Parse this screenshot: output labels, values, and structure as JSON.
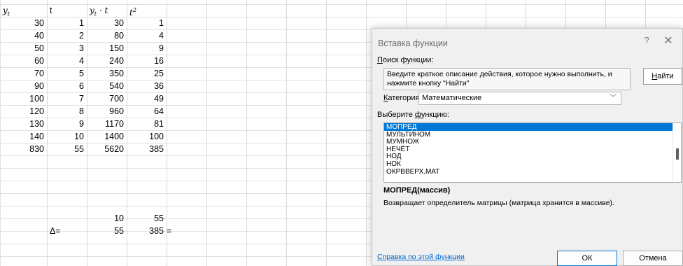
{
  "sheet": {
    "headers": {
      "col1": {
        "base": "y",
        "sub": "t"
      },
      "col2": "t",
      "col3": {
        "base": "y",
        "sub": "t",
        "rest": " · t"
      },
      "col4": {
        "base": "t",
        "sup": "2"
      }
    },
    "rows": [
      [
        "30",
        "1",
        "30",
        "1"
      ],
      [
        "40",
        "2",
        "80",
        "4"
      ],
      [
        "50",
        "3",
        "150",
        "9"
      ],
      [
        "60",
        "4",
        "240",
        "16"
      ],
      [
        "70",
        "5",
        "350",
        "25"
      ],
      [
        "90",
        "6",
        "540",
        "36"
      ],
      [
        "100",
        "7",
        "700",
        "49"
      ],
      [
        "120",
        "8",
        "960",
        "64"
      ],
      [
        "130",
        "9",
        "1170",
        "81"
      ],
      [
        "140",
        "10",
        "1400",
        "100"
      ],
      [
        "830",
        "55",
        "5620",
        "385"
      ]
    ],
    "matrix_top": [
      "10",
      "55"
    ],
    "delta_label": "Δ=",
    "matrix_bottom": [
      "55",
      "385"
    ],
    "formula_sign": "="
  },
  "dialog": {
    "title": "Вставка функции",
    "help_glyph": "?",
    "close_glyph": "✕",
    "search_label_u": "П",
    "search_label_rest": "оиск функции:",
    "search_text": "Введите краткое описание действия, которое нужно выполнить, и нажмите кнопку \"Найти\"",
    "find_button_u": "Н",
    "find_button_rest": "айти",
    "category_label_u": "К",
    "category_label_rest": "атегория:",
    "category_value": "Математические",
    "choose_label_pre": "Выберите ",
    "choose_label_u": "ф",
    "choose_label_rest": "ункцию:",
    "functions": [
      "МОПРЕД",
      "МУЛЬТИНОМ",
      "МУМНОЖ",
      "НЕЧЁТ",
      "НОД",
      "НОК",
      "ОКРВВЕРХ.МАТ"
    ],
    "selected_function": "МОПРЕД",
    "signature": "МОПРЕД(массив)",
    "description": "Возвращает определитель матрицы (матрица хранится в массиве).",
    "help_link": "Справка по этой функции",
    "ok_label": "ОК",
    "cancel_label": "Отмена"
  }
}
